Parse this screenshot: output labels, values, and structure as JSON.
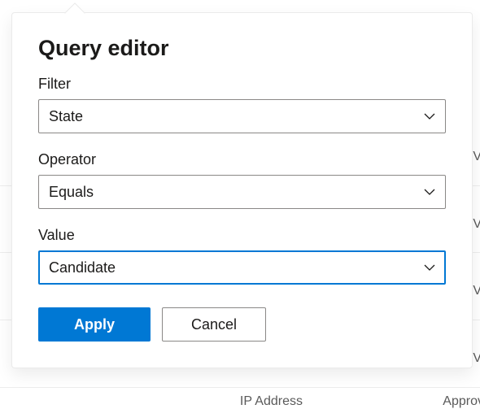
{
  "panel": {
    "title": "Query editor",
    "fields": {
      "filter": {
        "label": "Filter",
        "value": "State"
      },
      "operator": {
        "label": "Operator",
        "value": "Equals"
      },
      "value": {
        "label": "Value",
        "value": "Candidate"
      }
    },
    "buttons": {
      "apply": "Apply",
      "cancel": "Cancel"
    }
  },
  "background": {
    "v1": "V",
    "v2": "V",
    "v3": "V",
    "v4": "V",
    "ip": "IP Address",
    "approv": "Approv"
  },
  "colors": {
    "accent": "#0078d4",
    "border": "#8a8886"
  }
}
